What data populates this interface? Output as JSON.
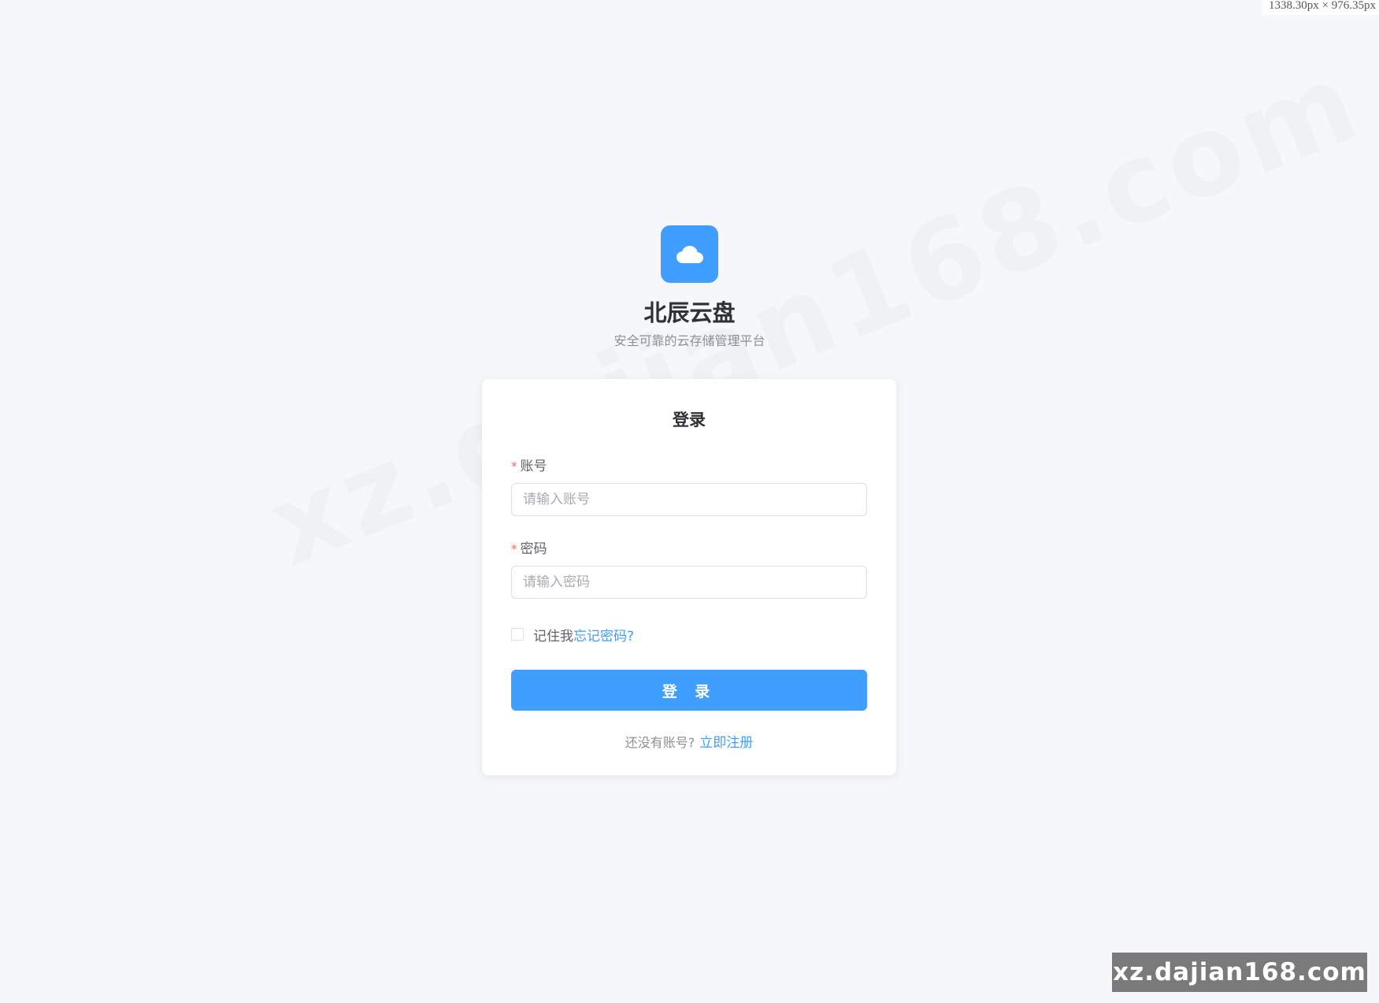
{
  "overlay": {
    "size_readout": "1338.30px × 976.35px"
  },
  "watermarks": {
    "diagonal": "xz.dajian168.com",
    "badge": "xz.dajian168.com"
  },
  "brand": {
    "logo_icon": "cloud-icon",
    "title": "北辰云盘",
    "subtitle": "安全可靠的云存储管理平台"
  },
  "login_card": {
    "title": "登录",
    "account": {
      "label": "账号",
      "required_mark": "*",
      "placeholder": "请输入账号",
      "value": ""
    },
    "password": {
      "label": "密码",
      "required_mark": "*",
      "placeholder": "请输入密码",
      "value": ""
    },
    "remember_label": "记住我",
    "remember_checked": false,
    "forgot_link": "忘记密码?",
    "submit_label": "登 录",
    "no_account_text": "还没有账号?",
    "register_link": "立即注册"
  },
  "colors": {
    "page_background": "#f5f7fa",
    "primary": "#409eff",
    "required": "#f56c6c",
    "card_background": "#ffffff"
  }
}
